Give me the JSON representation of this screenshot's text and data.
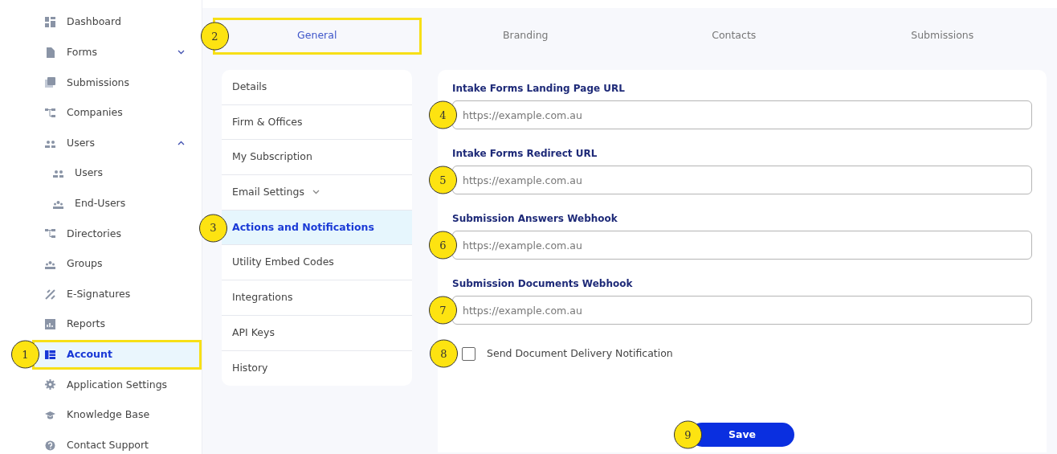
{
  "sidebar": {
    "items": [
      {
        "label": "Dashboard",
        "selected": false,
        "highlighted": false
      },
      {
        "label": "Forms",
        "selected": false,
        "highlighted": false,
        "expanded": false
      },
      {
        "label": "Submissions",
        "selected": false,
        "highlighted": false
      },
      {
        "label": "Companies",
        "selected": false,
        "highlighted": false
      },
      {
        "label": "Users",
        "selected": false,
        "highlighted": false,
        "expanded": true,
        "children": [
          {
            "label": "Users",
            "selected": false
          },
          {
            "label": "End-Users",
            "selected": false
          }
        ]
      },
      {
        "label": "Directories",
        "selected": false,
        "highlighted": false
      },
      {
        "label": "Groups",
        "selected": false,
        "highlighted": false
      },
      {
        "label": "E-Signatures",
        "selected": false,
        "highlighted": false
      },
      {
        "label": "Reports",
        "selected": false,
        "highlighted": false
      },
      {
        "label": "Account",
        "selected": true,
        "highlighted": true,
        "callout": "1"
      },
      {
        "label": "Application Settings",
        "selected": false,
        "highlighted": false
      },
      {
        "label": "Knowledge Base",
        "selected": false,
        "highlighted": false
      },
      {
        "label": "Contact Support",
        "selected": false,
        "highlighted": false
      }
    ]
  },
  "tabs": [
    {
      "label": "General",
      "selected": true,
      "highlighted": true,
      "callout": "2"
    },
    {
      "label": "Branding",
      "selected": false,
      "highlighted": false
    },
    {
      "label": "Contacts",
      "selected": false,
      "highlighted": false
    },
    {
      "label": "Submissions",
      "selected": false,
      "highlighted": false
    }
  ],
  "settings_menu": [
    {
      "label": "Details",
      "selected": false
    },
    {
      "label": "Firm & Offices",
      "selected": false
    },
    {
      "label": "My Subscription",
      "selected": false
    },
    {
      "label": "Email Settings",
      "selected": false,
      "expanded": false
    },
    {
      "label": "Actions and Notifications",
      "selected": true,
      "callout": "3"
    },
    {
      "label": "Utility Embed Codes",
      "selected": false
    },
    {
      "label": "Integrations",
      "selected": false
    },
    {
      "label": "API Keys",
      "selected": false
    },
    {
      "label": "History",
      "selected": false
    }
  ],
  "form": {
    "fields": [
      {
        "label": "Intake Forms Landing Page URL",
        "placeholder": "https://example.com.au",
        "callout": "4"
      },
      {
        "label": "Intake Forms Redirect URL",
        "placeholder": "https://example.com.au",
        "callout": "5"
      },
      {
        "label": "Submission Answers Webhook",
        "placeholder": "https://example.com.au",
        "callout": "6"
      },
      {
        "label": "Submission Documents Webhook",
        "placeholder": "https://example.com.au",
        "callout": "7"
      }
    ],
    "checkbox": {
      "label": "Send Document Delivery Notification",
      "checked": false,
      "callout": "8"
    },
    "save_button": {
      "label": "Save",
      "callout": "9"
    }
  }
}
